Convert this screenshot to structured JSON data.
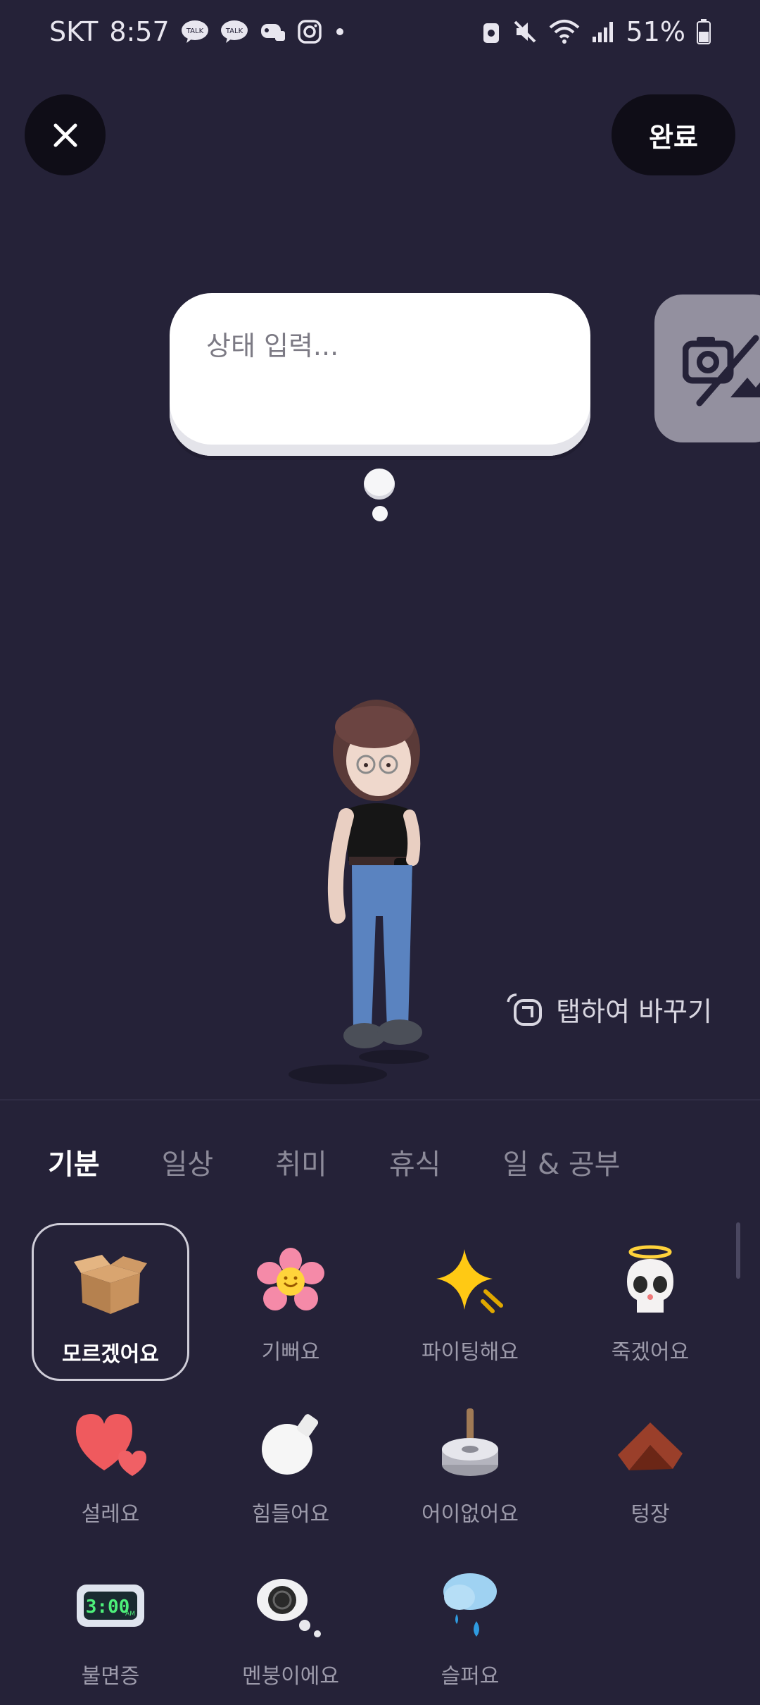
{
  "status_bar": {
    "carrier": "SKT",
    "time": "8:57",
    "chat_badge_1": "TALK",
    "chat_badge_2": "TALK",
    "battery": "51%"
  },
  "header": {
    "close_icon": "close-icon",
    "done_label": "완료"
  },
  "status_bubble": {
    "placeholder": "상태 입력..."
  },
  "photo_card": {
    "icon": "camera-off-icon"
  },
  "tap_hint": {
    "icon": "tap-hand-icon",
    "label": "탭하여 바꾸기"
  },
  "tabs": [
    {
      "label": "기분",
      "active": true
    },
    {
      "label": "일상",
      "active": false
    },
    {
      "label": "취미",
      "active": false
    },
    {
      "label": "휴식",
      "active": false
    },
    {
      "label": "일 & 공부",
      "active": false
    }
  ],
  "moods": [
    {
      "label": "모르겠어요",
      "icon": "box-icon",
      "selected": true
    },
    {
      "label": "기뻐요",
      "icon": "flower-icon",
      "selected": false
    },
    {
      "label": "파이팅해요",
      "icon": "sparkle-icon",
      "selected": false
    },
    {
      "label": "죽겠어요",
      "icon": "skull-angel-icon",
      "selected": false
    },
    {
      "label": "설레요",
      "icon": "heart-icon",
      "selected": false
    },
    {
      "label": "힘들어요",
      "icon": "bomb-icon",
      "selected": false
    },
    {
      "label": "어이없어요",
      "icon": "tape-roll-icon",
      "selected": false
    },
    {
      "label": "텅장",
      "icon": "empty-wallet-icon",
      "selected": false
    },
    {
      "label": "불면증",
      "icon": "alarm-clock-icon",
      "selected": false
    },
    {
      "label": "멘붕이에요",
      "icon": "scribble-cloud-icon",
      "selected": false
    },
    {
      "label": "슬퍼요",
      "icon": "rain-cloud-icon",
      "selected": false
    }
  ],
  "clock_display": "3:00",
  "clock_suffix": "AM",
  "colors": {
    "background": "#252238",
    "button_bg": "#0f0d17",
    "tab_active": "#ffffff",
    "tab_inactive": "#8c8a99"
  }
}
